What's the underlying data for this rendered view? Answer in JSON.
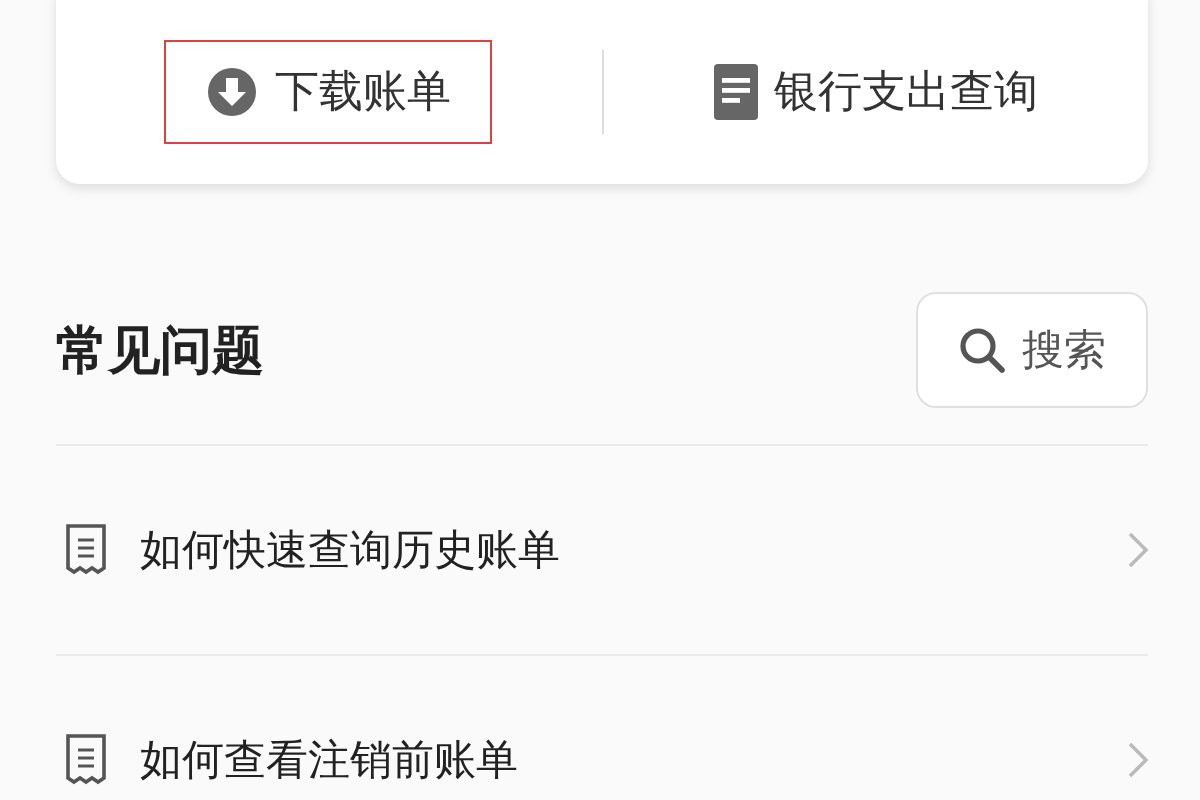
{
  "actions": [
    {
      "kind": "download",
      "label": "下载账单",
      "highlighted": true
    },
    {
      "kind": "document",
      "label": "银行支出查询",
      "highlighted": false
    }
  ],
  "faq": {
    "title": "常见问题",
    "search": {
      "label": "搜索"
    },
    "items": [
      {
        "label": "如何快速查询历史账单"
      },
      {
        "label": "如何查看注销前账单"
      }
    ]
  }
}
